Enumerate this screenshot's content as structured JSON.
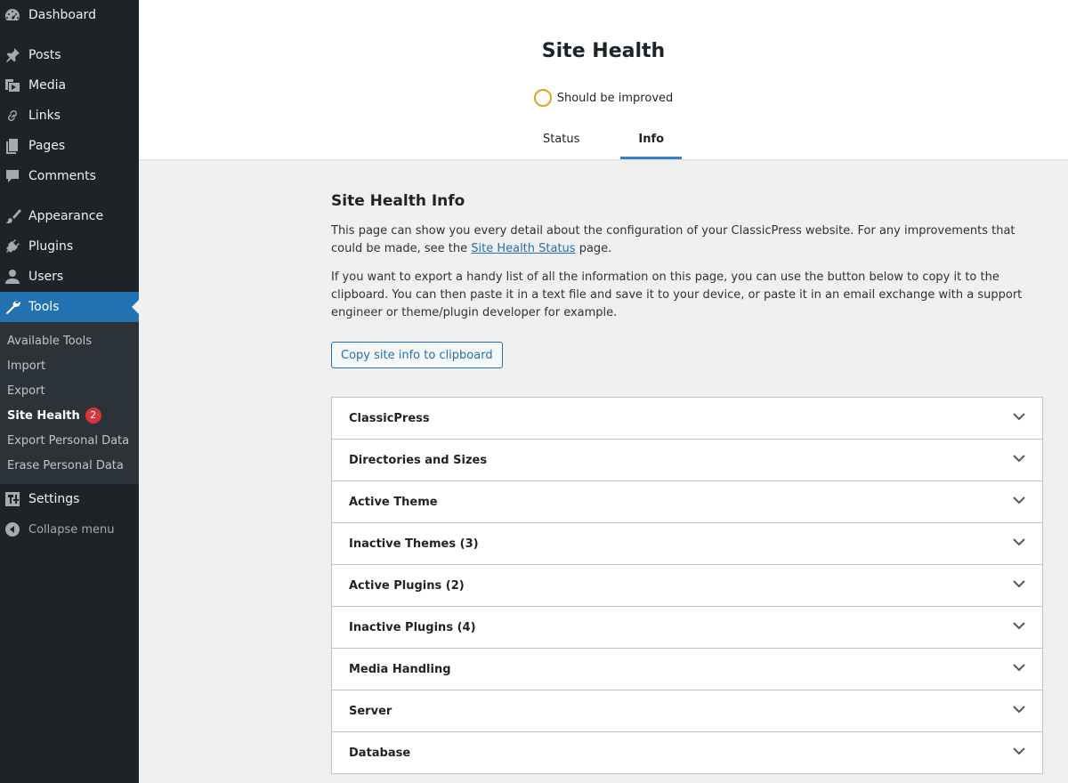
{
  "sidebar": {
    "top_items": [
      {
        "label": "Dashboard",
        "icon": "dashboard-icon"
      }
    ],
    "group1": [
      {
        "label": "Posts",
        "icon": "pin-icon"
      },
      {
        "label": "Media",
        "icon": "media-icon"
      },
      {
        "label": "Links",
        "icon": "link-icon"
      },
      {
        "label": "Pages",
        "icon": "pages-icon"
      },
      {
        "label": "Comments",
        "icon": "comment-icon"
      }
    ],
    "group2": [
      {
        "label": "Appearance",
        "icon": "brush-icon"
      },
      {
        "label": "Plugins",
        "icon": "plug-icon"
      },
      {
        "label": "Users",
        "icon": "user-icon"
      },
      {
        "label": "Tools",
        "icon": "wrench-icon"
      }
    ],
    "tools_submenu": [
      {
        "label": "Available Tools"
      },
      {
        "label": "Import"
      },
      {
        "label": "Export"
      },
      {
        "label": "Site Health",
        "badge": "2"
      },
      {
        "label": "Export Personal Data"
      },
      {
        "label": "Erase Personal Data"
      }
    ],
    "settings": {
      "label": "Settings",
      "icon": "settings-icon"
    },
    "collapse": {
      "label": "Collapse menu",
      "icon": "collapse-icon"
    }
  },
  "header": {
    "title": "Site Health",
    "status": "Should be improved",
    "tabs": [
      {
        "label": "Status"
      },
      {
        "label": "Info"
      }
    ]
  },
  "main": {
    "heading": "Site Health Info",
    "para1_before": "This page can show you every detail about the configuration of your ClassicPress website. For any improvements that could be made, see the ",
    "para1_link": "Site Health Status",
    "para1_after": " page.",
    "para2": "If you want to export a handy list of all the information on this page, you can use the button below to copy it to the clipboard. You can then paste it in a text file and save it to your device, or paste it in an email exchange with a support engineer or theme/plugin developer for example.",
    "copy_button": "Copy site info to clipboard",
    "sections": [
      "ClassicPress",
      "Directories and Sizes",
      "Active Theme",
      "Inactive Themes (3)",
      "Active Plugins (2)",
      "Inactive Plugins (4)",
      "Media Handling",
      "Server",
      "Database"
    ]
  },
  "colors": {
    "sidebar_bg": "#1d2327",
    "accent": "#2271b1",
    "badge": "#d63638",
    "status_ring": "#dba617"
  }
}
